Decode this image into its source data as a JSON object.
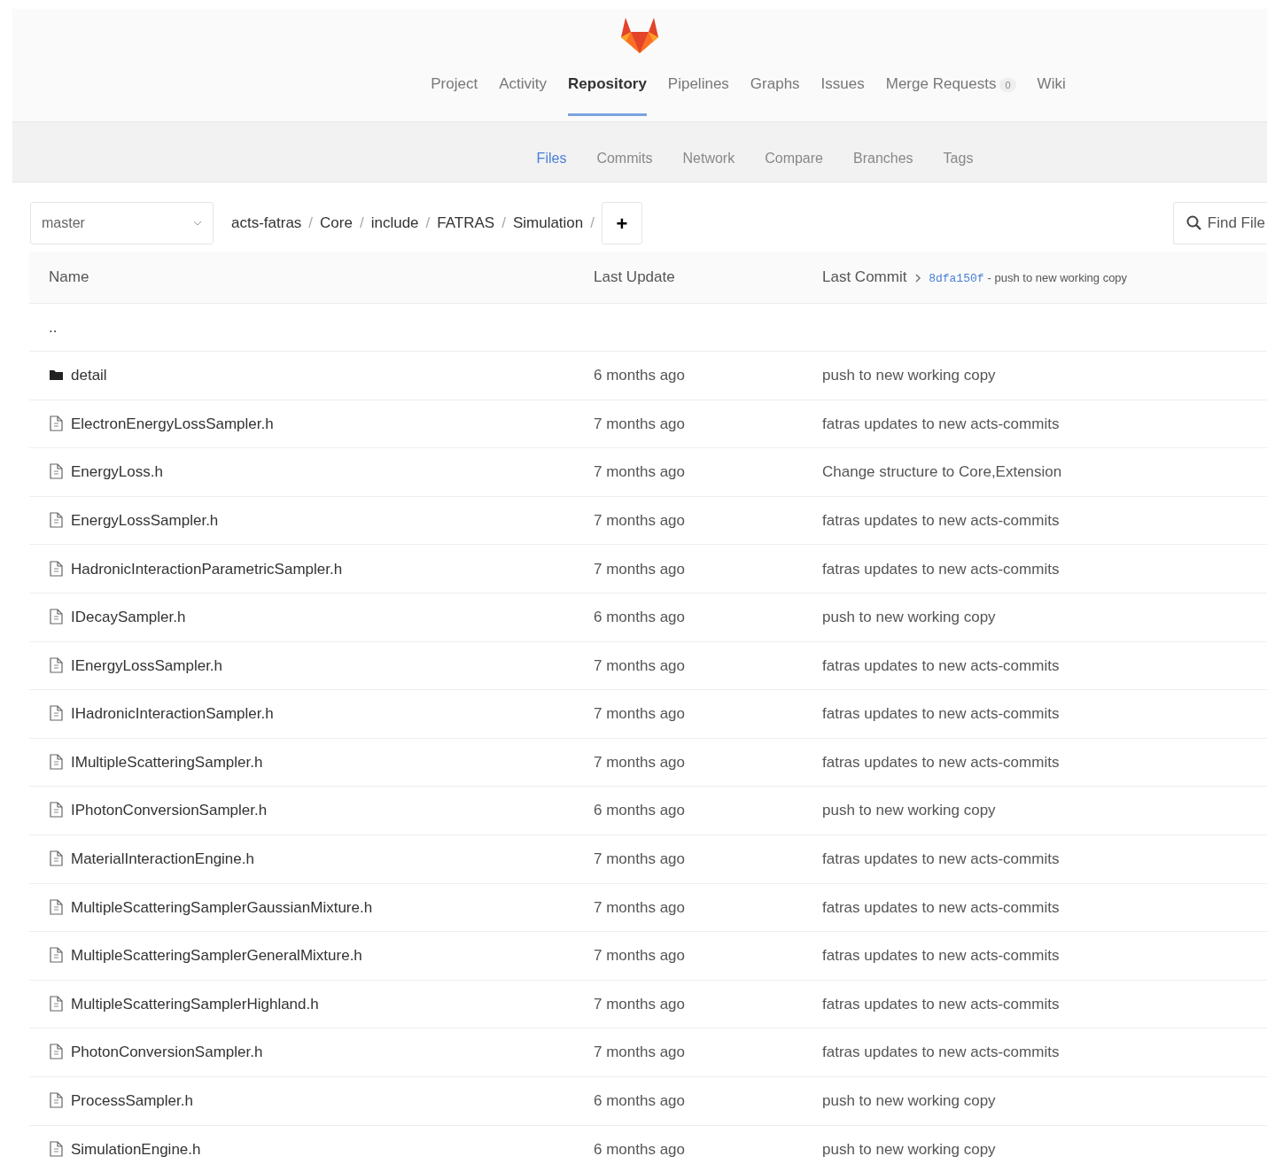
{
  "nav": {
    "tabs": [
      {
        "label": "Project",
        "selected": false
      },
      {
        "label": "Activity",
        "selected": false
      },
      {
        "label": "Repository",
        "selected": true
      },
      {
        "label": "Pipelines",
        "selected": false
      },
      {
        "label": "Graphs",
        "selected": false
      },
      {
        "label": "Issues",
        "selected": false
      },
      {
        "label": "Merge Requests",
        "count": "0",
        "selected": false
      },
      {
        "label": "Wiki",
        "selected": false
      }
    ]
  },
  "subnav": {
    "tabs": [
      {
        "label": "Files",
        "selected": true
      },
      {
        "label": "Commits",
        "selected": false
      },
      {
        "label": "Network",
        "selected": false
      },
      {
        "label": "Compare",
        "selected": false
      },
      {
        "label": "Branches",
        "selected": false
      },
      {
        "label": "Tags",
        "selected": false
      }
    ]
  },
  "toolbar": {
    "branch": "master",
    "breadcrumb": [
      "acts-fatras",
      "Core",
      "include",
      "FATRAS",
      "Simulation"
    ],
    "separator": "/",
    "add_button": "+",
    "find_button": "Find File"
  },
  "table": {
    "columns": [
      "Name",
      "Last Update",
      "Last Commit"
    ],
    "last_commit": {
      "sha": "8dfa150f",
      "message": "- push to new working copy"
    },
    "parent": "..",
    "rows": [
      {
        "kind": "folder",
        "name": "detail",
        "updated": "6 months ago",
        "commit": "push to new working copy"
      },
      {
        "kind": "file",
        "name": "ElectronEnergyLossSampler.h",
        "updated": "7 months ago",
        "commit": "fatras updates to new acts-commits"
      },
      {
        "kind": "file",
        "name": "EnergyLoss.h",
        "updated": "7 months ago",
        "commit": "Change structure to Core,Extension"
      },
      {
        "kind": "file",
        "name": "EnergyLossSampler.h",
        "updated": "7 months ago",
        "commit": "fatras updates to new acts-commits"
      },
      {
        "kind": "file",
        "name": "HadronicInteractionParametricSampler.h",
        "updated": "7 months ago",
        "commit": "fatras updates to new acts-commits"
      },
      {
        "kind": "file",
        "name": "IDecaySampler.h",
        "updated": "6 months ago",
        "commit": "push to new working copy"
      },
      {
        "kind": "file",
        "name": "IEnergyLossSampler.h",
        "updated": "7 months ago",
        "commit": "fatras updates to new acts-commits"
      },
      {
        "kind": "file",
        "name": "IHadronicInteractionSampler.h",
        "updated": "7 months ago",
        "commit": "fatras updates to new acts-commits"
      },
      {
        "kind": "file",
        "name": "IMultipleScatteringSampler.h",
        "updated": "7 months ago",
        "commit": "fatras updates to new acts-commits"
      },
      {
        "kind": "file",
        "name": "IPhotonConversionSampler.h",
        "updated": "6 months ago",
        "commit": "push to new working copy"
      },
      {
        "kind": "file",
        "name": "MaterialInteractionEngine.h",
        "updated": "7 months ago",
        "commit": "fatras updates to new acts-commits"
      },
      {
        "kind": "file",
        "name": "MultipleScatteringSamplerGaussianMixture.h",
        "updated": "7 months ago",
        "commit": "fatras updates to new acts-commits"
      },
      {
        "kind": "file",
        "name": "MultipleScatteringSamplerGeneralMixture.h",
        "updated": "7 months ago",
        "commit": "fatras updates to new acts-commits"
      },
      {
        "kind": "file",
        "name": "MultipleScatteringSamplerHighland.h",
        "updated": "7 months ago",
        "commit": "fatras updates to new acts-commits"
      },
      {
        "kind": "file",
        "name": "PhotonConversionSampler.h",
        "updated": "7 months ago",
        "commit": "fatras updates to new acts-commits"
      },
      {
        "kind": "file",
        "name": "ProcessSampler.h",
        "updated": "6 months ago",
        "commit": "push to new working copy"
      },
      {
        "kind": "file",
        "name": "SimulationEngine.h",
        "updated": "6 months ago",
        "commit": "push to new working copy"
      }
    ]
  }
}
